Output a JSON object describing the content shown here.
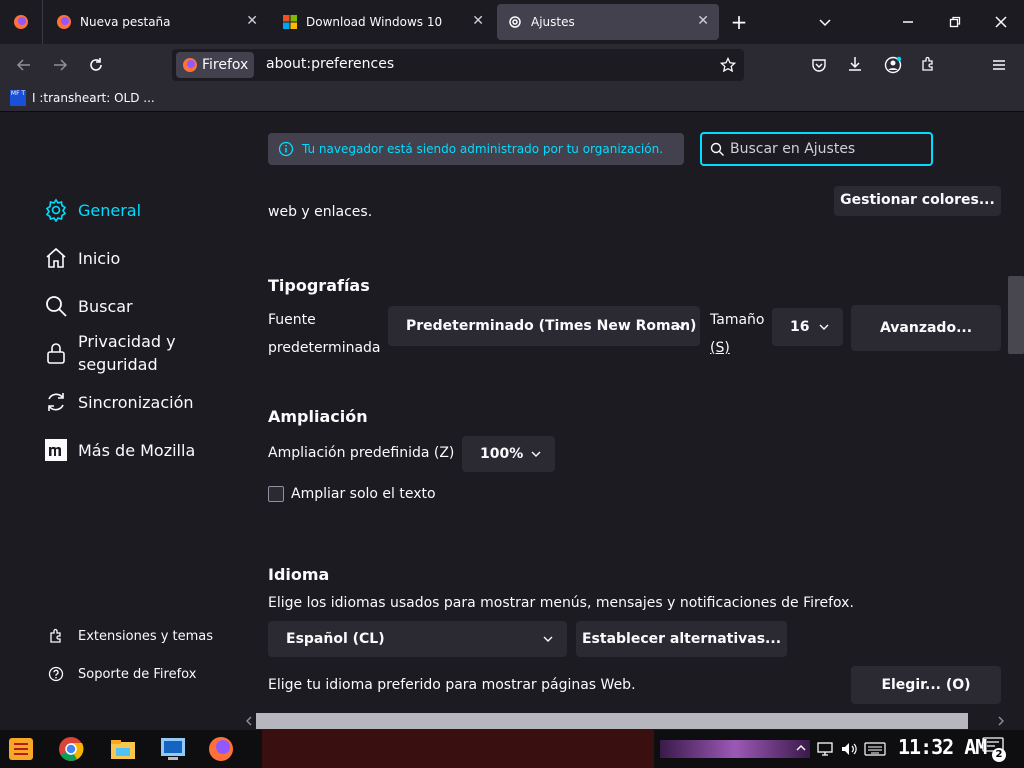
{
  "tabs": [
    {
      "title": "Nueva pestaña",
      "icon": "firefox-icon"
    },
    {
      "title": "Download Windows 10",
      "icon": "windows-icon"
    },
    {
      "title": "Ajustes",
      "icon": "gear-icon",
      "active": true
    }
  ],
  "navbar": {
    "identity": "Firefox",
    "url": "about:preferences"
  },
  "bookmarks": [
    {
      "label": "I :transheart: OLD ...",
      "fav": "MF T"
    }
  ],
  "sidebar": {
    "items": [
      {
        "label": "General",
        "icon": "gear-icon",
        "selected": true
      },
      {
        "label": "Inicio",
        "icon": "home-icon"
      },
      {
        "label": "Buscar",
        "icon": "search-icon"
      },
      {
        "label": "Privacidad y seguridad",
        "line1": "Privacidad y",
        "line2": "seguridad",
        "icon": "lock-icon"
      },
      {
        "label": "Sincronización",
        "icon": "sync-icon"
      },
      {
        "label": "Más de Mozilla",
        "icon": "mozilla-icon"
      }
    ],
    "footer": [
      {
        "label": "Extensiones y temas",
        "icon": "puzzle-icon"
      },
      {
        "label": "Soporte de Firefox",
        "icon": "help-icon"
      }
    ]
  },
  "policy_notice": "Tu navegador está siendo administrado por tu organización.",
  "search": {
    "placeholder": "Buscar en Ajustes"
  },
  "prev_section": {
    "tail_text": "web y enlaces.",
    "manage_colors": "Gestionar colores..."
  },
  "fonts": {
    "heading": "Tipografías",
    "default_label_1": "Fuente",
    "default_label_2": "predeterminada",
    "default_value": "Predeterminado (Times New Roman)",
    "size_label_1": "Tamaño",
    "size_label_2": "(S)",
    "size_value": "16",
    "advanced": "Avanzado..."
  },
  "zoom": {
    "heading": "Ampliación",
    "default_label": "Ampliación predefinida (Z)",
    "default_value": "100%",
    "text_only_label": "Ampliar solo el texto",
    "text_only_checked": false
  },
  "language": {
    "heading": "Idioma",
    "desc": "Elige los idiomas usados para mostrar menús, mensajes y notificaciones de Firefox.",
    "value": "Español (CL)",
    "alternatives": "Establecer alternativas...",
    "web_desc": "Elige tu idioma preferido para mostrar páginas Web.",
    "choose": "Elegir... (O)"
  },
  "taskbar": {
    "clock": "11:32 AM",
    "notifications": "2"
  }
}
